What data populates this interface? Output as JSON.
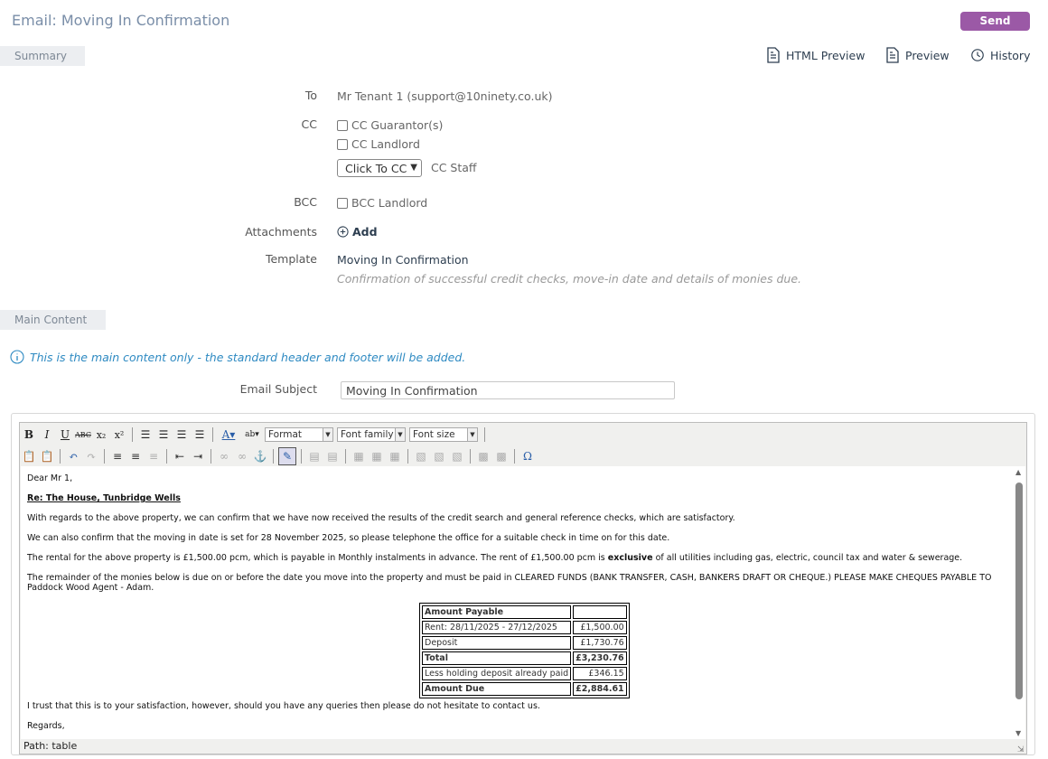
{
  "header": {
    "title": "Email: Moving In Confirmation",
    "send_label": "Send",
    "summary_tab": "Summary",
    "actions": [
      {
        "label": "HTML Preview",
        "icon": "document-code-icon"
      },
      {
        "label": "Preview",
        "icon": "document-icon"
      },
      {
        "label": "History",
        "icon": "history-icon"
      }
    ]
  },
  "form": {
    "to_label": "To",
    "to_value": "Mr Tenant 1 (support@10ninety.co.uk)",
    "cc_label": "CC",
    "cc_guarantor": "CC Guarantor(s)",
    "cc_landlord": "CC Landlord",
    "cc_select": "Click To CC",
    "cc_staff": "CC Staff",
    "bcc_label": "BCC",
    "bcc_landlord": "BCC Landlord",
    "attachments_label": "Attachments",
    "add_label": "Add",
    "template_label": "Template",
    "template_name": "Moving In Confirmation",
    "template_desc": "Confirmation of successful credit checks, move-in date and details of monies due."
  },
  "main": {
    "tab": "Main Content",
    "info": "This is the main content only - the standard header and footer will be added.",
    "subject_label": "Email Subject",
    "subject_value": "Moving In Confirmation"
  },
  "editor": {
    "format": "Format",
    "font_family": "Font family",
    "font_size": "Font size",
    "path": "Path: table",
    "greeting": "Dear Mr 1,",
    "re_line": "Re: The House, Tunbridge Wells",
    "p1": "With regards to the above property, we can confirm that we have now received the results of the credit search and general reference checks, which are satisfactory.",
    "p2": "We can also confirm that the moving in date is set for 28 November 2025, so please telephone the office for a suitable check in time on for this date.",
    "p3_a": "The rental for the above property is £1,500.00 pcm, which is payable in Monthly instalments in advance. The rent of £1,500.00 pcm is ",
    "p3_b": "exclusive",
    "p3_c": " of all utilities including gas, electric, council tax and water & sewerage.",
    "p4": "The remainder of the monies below is due on or before the date you move into the property and must be paid in CLEARED FUNDS (BANK TRANSFER, CASH, BANKERS DRAFT OR CHEQUE.) PLEASE MAKE CHEQUES PAYABLE TO Paddock Wood Agent - Adam.",
    "closing": "I trust that this is to your satisfaction, however, should you have any queries then please do not hesitate to contact us.",
    "regards": "Regards,",
    "table": [
      {
        "label": "Amount Payable",
        "value": "",
        "bold": true
      },
      {
        "label": "Rent: 28/11/2025 - 27/12/2025",
        "value": "£1,500.00",
        "bold": false
      },
      {
        "label": "Deposit",
        "value": "£1,730.76",
        "bold": false
      },
      {
        "label": "Total",
        "value": "£3,230.76",
        "bold": true
      },
      {
        "label": "Less holding deposit already paid",
        "value": "£346.15",
        "bold": false
      },
      {
        "label": "Amount Due",
        "value": "£2,884.61",
        "bold": true
      }
    ]
  }
}
